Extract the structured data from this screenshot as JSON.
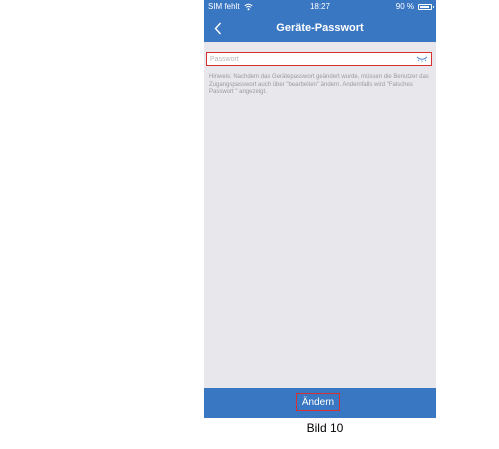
{
  "status_bar": {
    "carrier": "SIM fehlt",
    "time": "18:27",
    "battery": "90 %"
  },
  "nav": {
    "title": "Geräte-Passwort"
  },
  "password_field": {
    "value": "",
    "placeholder": "Passwort"
  },
  "hint": "Hinweis: Nachdem das Gerätepasswort geändert wurde, müssen die Benutzer das Zugangspasswort auch über \"bearbeiten\" ändern. Andernfalls wird  \"Falsches Passwort \" angezeigt.",
  "footer": {
    "submit_label": "Ändern"
  },
  "caption": "Bild 10",
  "colors": {
    "primary": "#3a77c2",
    "highlight": "#d73030",
    "background": "#e8e8ec"
  }
}
